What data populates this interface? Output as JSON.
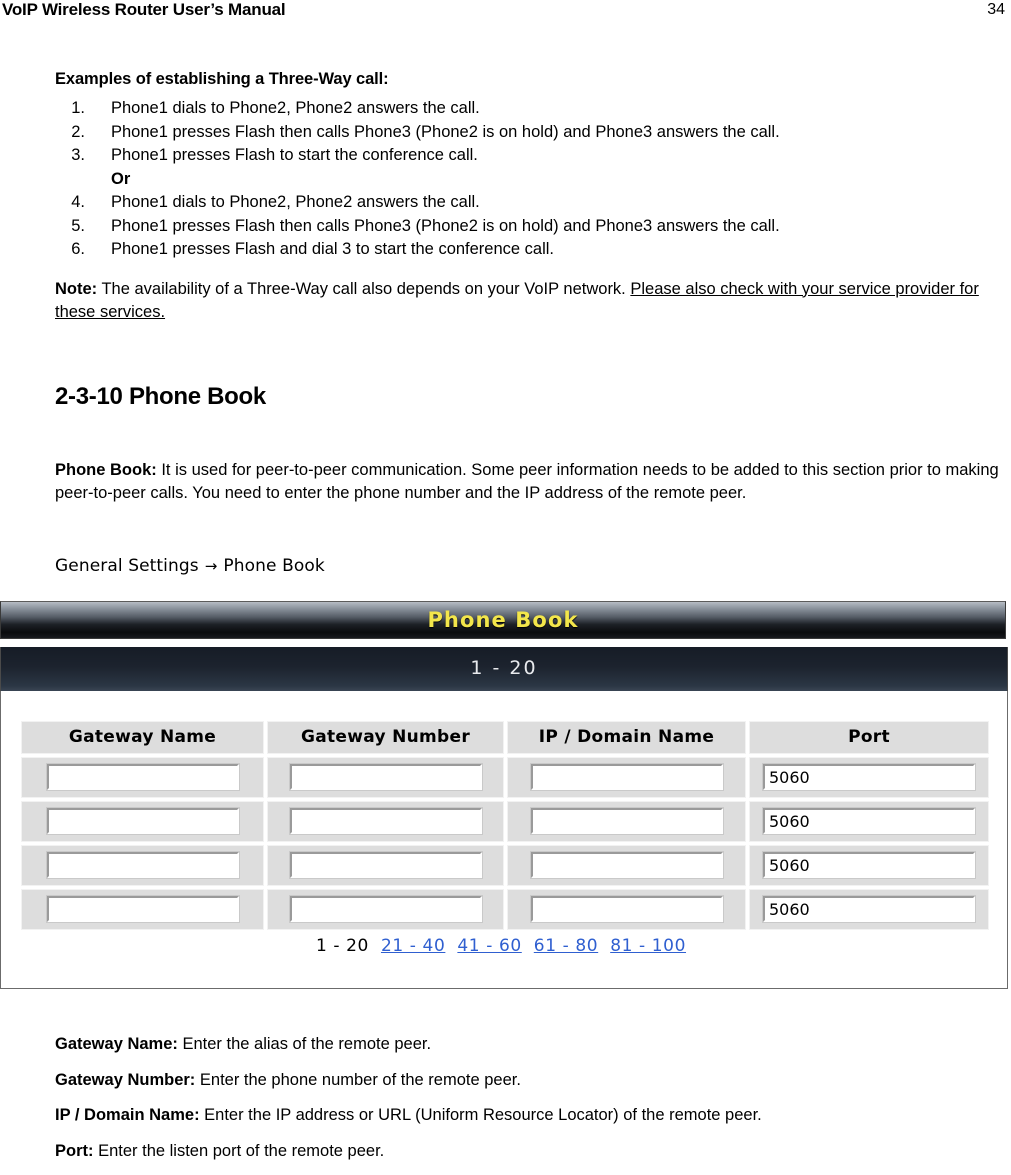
{
  "document": {
    "header_title": "VoIP Wireless Router User’s Manual",
    "page_number": "34"
  },
  "three_way": {
    "subhead": "Examples of establishing a Three-Way call:",
    "steps": [
      {
        "num": "1.",
        "text": "Phone1 dials to Phone2, Phone2 answers the call."
      },
      {
        "num": "2.",
        "text": "Phone1 presses Flash then calls Phone3 (Phone2 is on hold) and Phone3 answers the call."
      },
      {
        "num": "3.",
        "text": "Phone1 presses Flash to start the conference call."
      }
    ],
    "or_label": "Or",
    "steps2": [
      {
        "num": "4.",
        "text": "Phone1 dials to Phone2, Phone2 answers the call."
      },
      {
        "num": "5.",
        "text": "Phone1 presses Flash then calls Phone3 (Phone2 is on hold) and Phone3 answers the call."
      },
      {
        "num": "6.",
        "text": "Phone1 presses Flash and dial 3 to start the conference call."
      }
    ],
    "note_label": "Note:",
    "note_plain": " The availability of a Three-Way call also depends on your VoIP network. ",
    "note_underlined": "Please also check with your service provider for these services."
  },
  "section": {
    "title": "2-3-10 Phone Book",
    "desc_lead": "Phone Book:",
    "desc_text": " It is used for peer-to-peer communication. Some peer information needs to be added to this section prior to making peer-to-peer calls. You need to enter the phone number and the IP address of the remote peer.",
    "breadcrumb_root": "General Settings",
    "breadcrumb_arrow": "→",
    "breadcrumb_leaf": "Phone Book"
  },
  "ui_panel": {
    "title": "Phone Book",
    "range_label": "1 - 20",
    "columns": [
      "Gateway Name",
      "Gateway Number",
      "IP / Domain Name",
      "Port"
    ],
    "rows": [
      {
        "gateway_name": "",
        "gateway_number": "",
        "ip_domain": "",
        "port": "5060"
      },
      {
        "gateway_name": "",
        "gateway_number": "",
        "ip_domain": "",
        "port": "5060"
      },
      {
        "gateway_name": "",
        "gateway_number": "",
        "ip_domain": "",
        "port": "5060"
      },
      {
        "gateway_name": "",
        "gateway_number": "",
        "ip_domain": "",
        "port": "5060"
      }
    ],
    "pagination": {
      "current": "1 - 20",
      "links": [
        "21 - 40",
        "41 - 60",
        "61 - 80",
        "81 - 100"
      ]
    },
    "colors": {
      "title_text": "#f3e64b",
      "link": "#2f5fd0",
      "cell_bg": "#dddddd"
    }
  },
  "glossary": [
    {
      "lead": "Gateway Name:",
      "text": " Enter the alias of the remote peer."
    },
    {
      "lead": "Gateway Number:",
      "text": " Enter the phone number of the remote peer."
    },
    {
      "lead": "IP / Domain Name:",
      "text": " Enter the IP address or URL (Uniform Resource Locator) of the remote peer."
    },
    {
      "lead": "Port:",
      "text": " Enter the listen port of the remote peer."
    }
  ]
}
